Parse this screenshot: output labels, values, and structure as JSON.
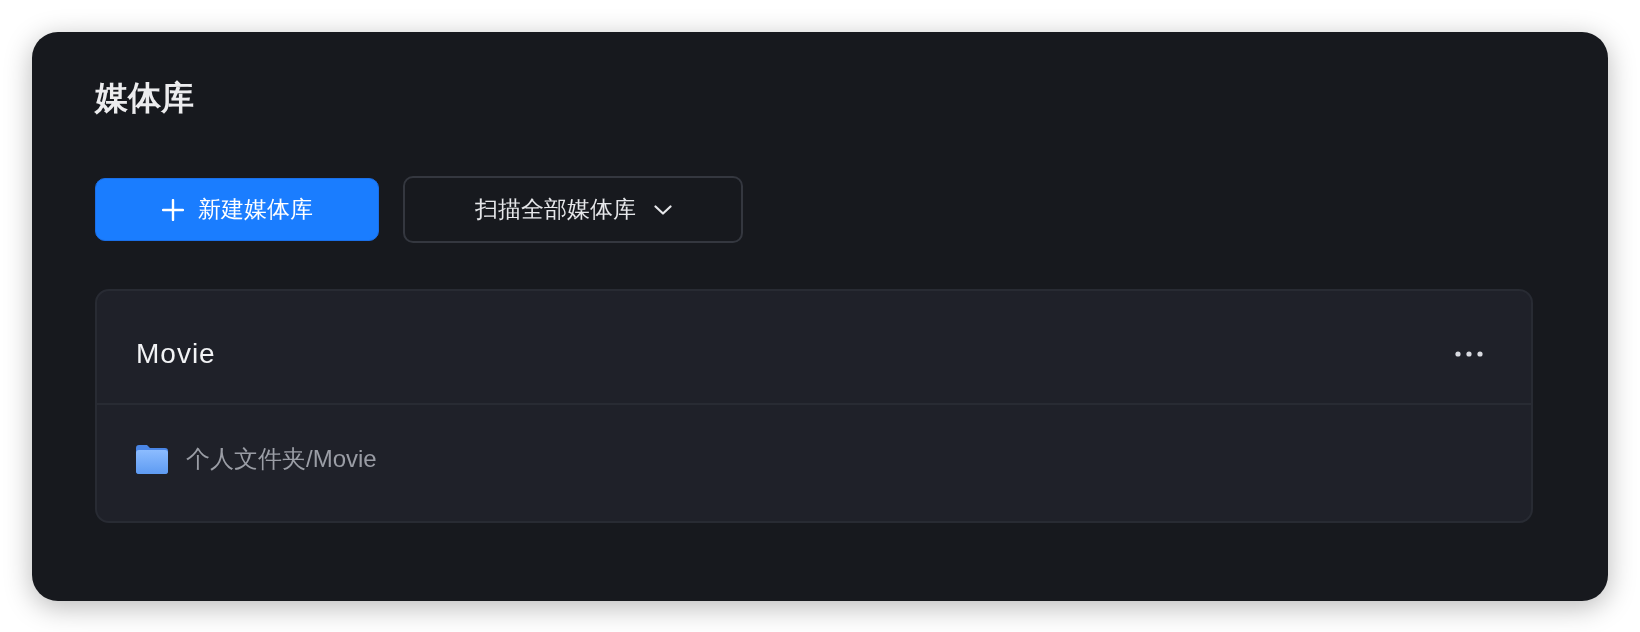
{
  "panel": {
    "title": "媒体库"
  },
  "actions": [
    {
      "kind": "primary",
      "label": "新建媒体库"
    },
    {
      "kind": "dropdown",
      "label": "扫描全部媒体库"
    }
  ],
  "libraries": [
    {
      "name": "Movie",
      "folders": [
        "个人文件夹/Movie"
      ]
    }
  ]
}
